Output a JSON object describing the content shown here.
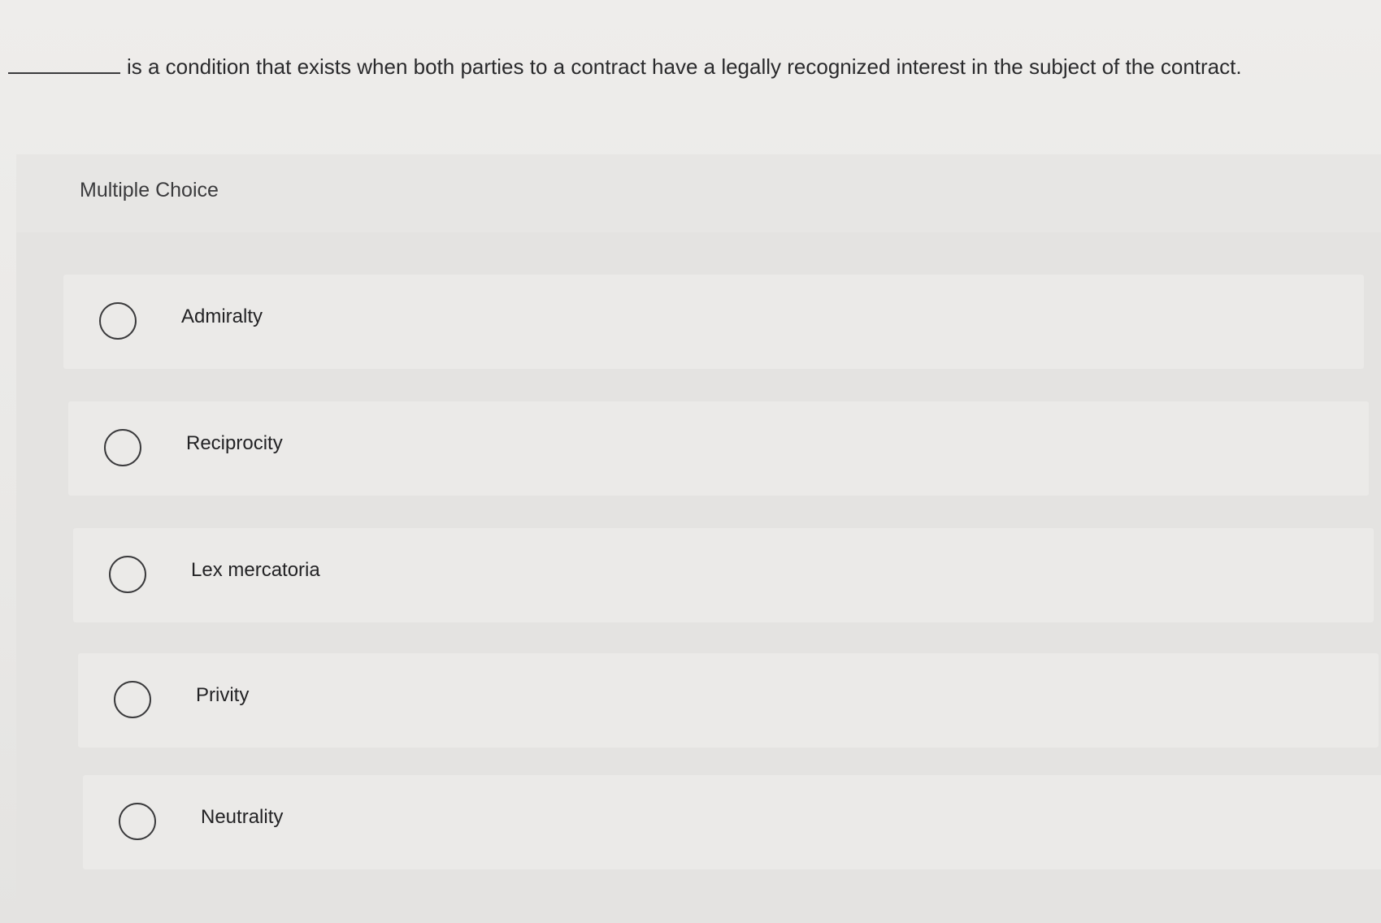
{
  "question": {
    "text": "is a condition that exists when both parties to a contract have a legally recognized interest in the subject of the contract."
  },
  "panel": {
    "label": "Multiple Choice"
  },
  "options": [
    {
      "label": "Admiralty"
    },
    {
      "label": "Reciprocity"
    },
    {
      "label": "Lex mercatoria"
    },
    {
      "label": "Privity"
    },
    {
      "label": "Neutrality"
    }
  ]
}
